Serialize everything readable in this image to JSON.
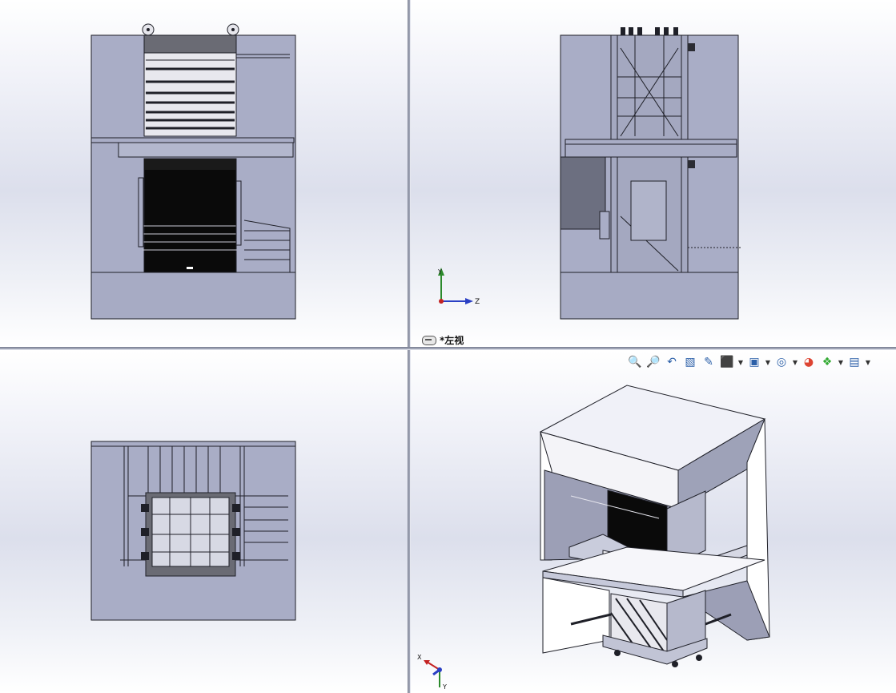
{
  "views": {
    "left_view_label": "*左视"
  },
  "triad": {
    "y_label": "Y",
    "z_label": "Z",
    "x_label": "X"
  },
  "heads_up_toolbar": {
    "icons": [
      "zoom-to-fit-icon",
      "zoom-to-area-icon",
      "previous-view-icon",
      "section-view-icon",
      "dynamic-annotation-icon",
      "view-orientation-icon",
      "display-style-icon",
      "hide-show-items-icon",
      "edit-appearance-icon",
      "apply-scene-icon",
      "view-settings-icon"
    ]
  },
  "colors": {
    "model_fill": "#a9adc6",
    "model_dark": "#5f6275",
    "edge": "#1f2028",
    "door_black": "#0a0a0a",
    "panel_light": "#e9e9ef"
  }
}
